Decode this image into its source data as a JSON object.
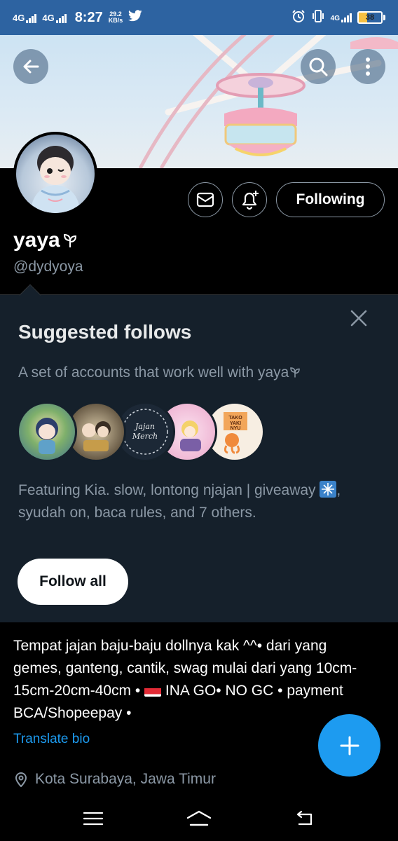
{
  "status_bar": {
    "net1": "4G",
    "net2": "4G",
    "time": "8:27",
    "speed_value": "29.2",
    "speed_unit": "KB/s",
    "net3": "4G",
    "battery_level": "38",
    "battery_fraction": 0.38,
    "icons": [
      "signal-icon",
      "twitter-icon",
      "alarm-icon",
      "vibrate-icon",
      "battery-icon"
    ]
  },
  "header": {
    "back_icon": "back-arrow-icon",
    "search_icon": "search-icon",
    "more_icon": "more-vertical-icon"
  },
  "profile": {
    "display_name": "yaya",
    "handle": "@dydyoya",
    "message_icon": "mail-icon",
    "notify_icon": "bell-plus-icon",
    "following_label": "Following"
  },
  "suggested": {
    "title": "Suggested follows",
    "subtitle": "A set of accounts that work well with yaya",
    "description_before": "Featuring Kia. slow, lontong njajan | giveaway",
    "description_after": ", syudah on, baca rules, and 7 others.",
    "avatar_texts": [
      "Jajan Merch",
      "TAKO YAKI NYU"
    ],
    "follow_all_label": "Follow all",
    "close_icon": "close-icon"
  },
  "bio": {
    "text_before": "Tempat jajan baju-baju dollnya kak ^^• dari yang gemes, ganteng, cantik, swag mulai dari yang 10cm-15cm-20cm-40cm •",
    "text_after": "INA GO• NO GC • payment BCA/Shopeepay •",
    "translate_label": "Translate bio",
    "location": "Kota Surabaya, Jawa Timur"
  },
  "fab": {
    "icon": "plus-icon"
  },
  "nav": {
    "icons": [
      "menu-icon",
      "home-icon",
      "back-icon"
    ]
  },
  "colors": {
    "accent": "#1d9bf0",
    "status_bar": "#2d63a1",
    "panel": "#15202b",
    "muted": "#8b98a5"
  }
}
